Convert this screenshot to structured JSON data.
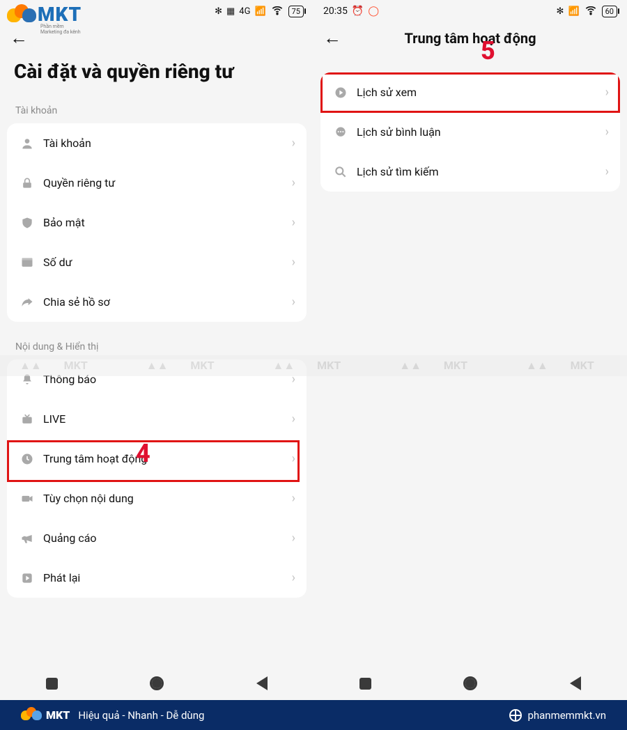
{
  "logo": {
    "brand": "MKT",
    "tagline": "Phần mềm Marketing đa kênh"
  },
  "left": {
    "status": {
      "battery": "75",
      "net": "4G"
    },
    "title": "Cài đặt và quyền riêng tư",
    "section1_header": "Tài khoản",
    "section1": [
      {
        "icon": "user-icon",
        "label": "Tài khoản"
      },
      {
        "icon": "lock-icon",
        "label": "Quyền riêng tư"
      },
      {
        "icon": "shield-icon",
        "label": "Bảo mật"
      },
      {
        "icon": "wallet-icon",
        "label": "Số dư"
      },
      {
        "icon": "share-icon",
        "label": "Chia sẻ hồ sơ"
      }
    ],
    "section2_header": "Nội dung & Hiển thị",
    "section2": [
      {
        "icon": "bell-icon",
        "label": "Thông báo"
      },
      {
        "icon": "live-icon",
        "label": "LIVE"
      },
      {
        "icon": "clock-icon",
        "label": "Trung tâm hoạt động"
      },
      {
        "icon": "video-icon",
        "label": "Tùy chọn nội dung"
      },
      {
        "icon": "megaphone-icon",
        "label": "Quảng cáo"
      },
      {
        "icon": "play-icon",
        "label": "Phát lại"
      }
    ]
  },
  "right": {
    "status": {
      "time": "20:35",
      "battery": "60"
    },
    "title": "Trung tâm hoạt động",
    "items": [
      {
        "icon": "play-circle-icon",
        "label": "Lịch sử xem"
      },
      {
        "icon": "comment-icon",
        "label": "Lịch sử bình luận"
      },
      {
        "icon": "search-icon",
        "label": "Lịch sử tìm kiếm"
      }
    ]
  },
  "annotations": {
    "step4": "4",
    "step5": "5"
  },
  "watermark": "MKT",
  "footer": {
    "slogan": "Hiệu quả - Nhanh - Dễ dùng",
    "url": "phanmemmkt.vn",
    "brand": "MKT"
  }
}
